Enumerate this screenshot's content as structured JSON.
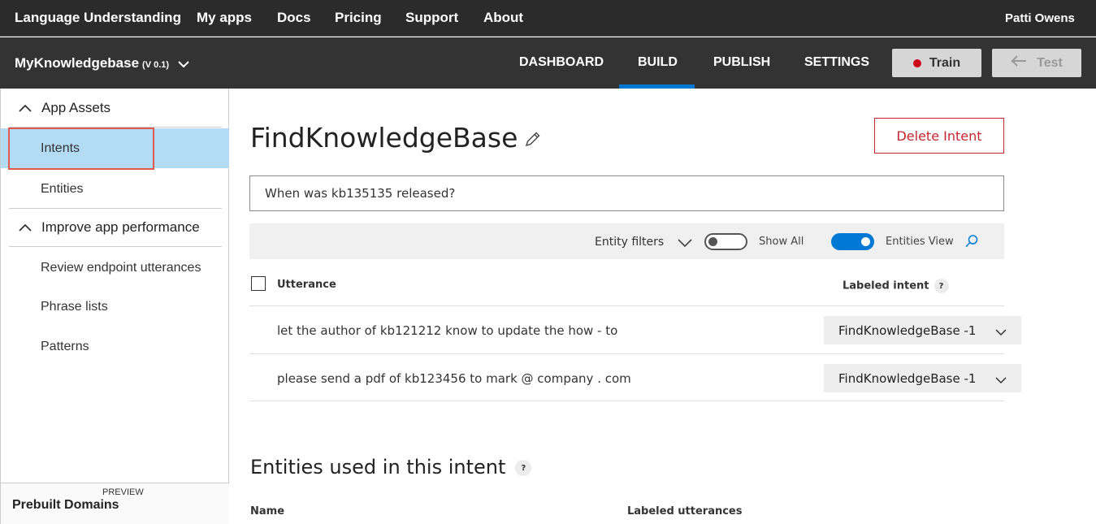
{
  "topnav": {
    "brand": "Language Understanding",
    "links": [
      "My apps",
      "Docs",
      "Pricing",
      "Support",
      "About"
    ],
    "user": "Patti Owens"
  },
  "appbar": {
    "app_name": "MyKnowledgebase",
    "version": "(V 0.1)",
    "tabs": [
      "DASHBOARD",
      "BUILD",
      "PUBLISH",
      "SETTINGS"
    ],
    "active_tab": "BUILD",
    "train_label": "Train",
    "test_label": "Test",
    "colors": {
      "accent": "#0078d4",
      "train_dot": "#d0021b"
    }
  },
  "sidebar": {
    "sections": [
      {
        "label": "App Assets",
        "items": [
          "Intents",
          "Entities"
        ]
      },
      {
        "label": "Improve app performance",
        "items": [
          "Review endpoint utterances",
          "Phrase lists",
          "Patterns"
        ]
      }
    ],
    "active_item": "Intents",
    "prebuilt_label": "Prebuilt Domains",
    "prebuilt_badge": "PREVIEW"
  },
  "main": {
    "intent_title": "FindKnowledgeBase",
    "delete_label": "Delete Intent",
    "utterance_input_value": "When was kb135135 released?",
    "filters": {
      "entity_filters_label": "Entity filters",
      "show_all_label": "Show All",
      "show_all_on": false,
      "entities_view_label": "Entities View",
      "entities_view_on": true
    },
    "table": {
      "columns": [
        "Utterance",
        "Labeled intent"
      ],
      "rows": [
        {
          "utterance": "let the author of kb121212 know to update the how - to",
          "intent": "FindKnowledgeBase -1"
        },
        {
          "utterance": "please send a pdf of kb123456 to mark @ company . com",
          "intent": "FindKnowledgeBase -1"
        }
      ]
    },
    "entities_section": {
      "title": "Entities used in this intent",
      "columns": [
        "Name",
        "Labeled utterances"
      ]
    }
  }
}
